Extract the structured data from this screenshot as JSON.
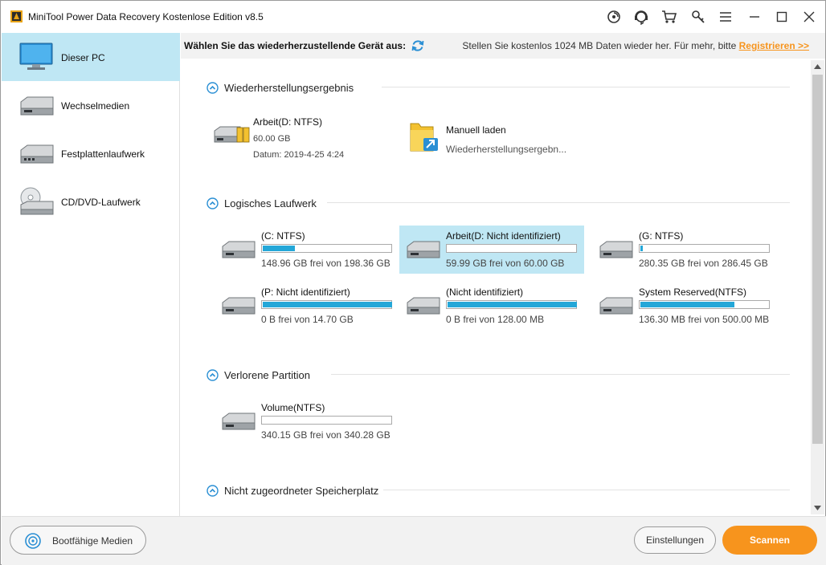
{
  "app": {
    "title": "MiniTool Power Data Recovery Kostenlose Edition v8.5"
  },
  "titlebar_icons": [
    "disc-icon",
    "support-icon",
    "cart-icon",
    "key-icon",
    "menu-icon",
    "minimize-icon",
    "maximize-icon",
    "close-icon"
  ],
  "sidebar": {
    "items": [
      {
        "label": "Dieser PC",
        "icon": "monitor-icon",
        "active": true
      },
      {
        "label": "Wechselmedien",
        "icon": "removable-drive-icon",
        "active": false
      },
      {
        "label": "Festplattenlaufwerk",
        "icon": "hard-drive-icon",
        "active": false
      },
      {
        "label": "CD/DVD-Laufwerk",
        "icon": "cd-dvd-icon",
        "active": false
      }
    ]
  },
  "header": {
    "label": "Wählen Sie das wiederherzustellende Gerät aus:",
    "promo": "Stellen Sie kostenlos 1024 MB Daten wieder her. Für mehr, bitte",
    "register_link": "Registrieren >>"
  },
  "sections": {
    "results": {
      "title": "Wiederherstellungsergebnis",
      "items": [
        {
          "name": "Arbeit(D: NTFS)",
          "size": "60.00 GB",
          "date": "Datum: 2019-4-25 4:24"
        },
        {
          "name": "Manuell laden",
          "sub": "Wiederherstellungsergebn..."
        }
      ]
    },
    "logical": {
      "title": "Logisches Laufwerk",
      "drives": [
        {
          "name": "(C: NTFS)",
          "free": "148.96 GB frei von 198.36 GB",
          "used_fraction": 0.249,
          "selected": false
        },
        {
          "name": "Arbeit(D: Nicht identifiziert)",
          "free": "59.99 GB frei von 60.00 GB",
          "used_fraction": 0.0,
          "selected": true
        },
        {
          "name": "(G: NTFS)",
          "free": "280.35 GB frei von 286.45 GB",
          "used_fraction": 0.021,
          "selected": false
        },
        {
          "name": "(P: Nicht identifiziert)",
          "free": "0 B frei von 14.70 GB",
          "used_fraction": 1.0,
          "selected": false
        },
        {
          "name": "(Nicht identifiziert)",
          "free": "0 B frei von 128.00 MB",
          "used_fraction": 1.0,
          "selected": false
        },
        {
          "name": "System Reserved(NTFS)",
          "free": "136.30 MB frei von 500.00 MB",
          "used_fraction": 0.727,
          "selected": false
        }
      ]
    },
    "lost": {
      "title": "Verlorene Partition",
      "drives": [
        {
          "name": "Volume(NTFS)",
          "free": "340.15 GB frei von 340.28 GB",
          "used_fraction": 0.0
        }
      ]
    },
    "unallocated": {
      "title": "Nicht zugeordneter Speicherplatz"
    }
  },
  "footer": {
    "boot_label": "Bootfähige Medien",
    "settings_label": "Einstellungen",
    "scan_label": "Scannen"
  },
  "colors": {
    "accent": "#f7941d",
    "selection": "#bfe7f4",
    "bar_fill": "#24a7d8",
    "link": "#f7941d"
  }
}
